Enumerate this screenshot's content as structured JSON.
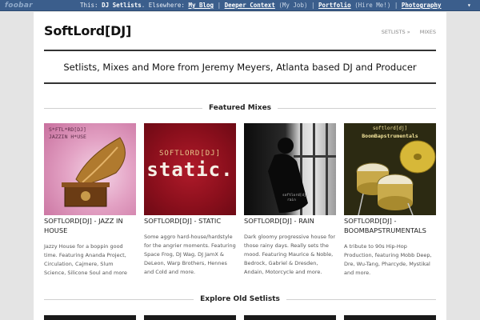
{
  "topbar": {
    "brand": "foobar",
    "this_label": "This:",
    "this_site": "DJ Setlists",
    "elsewhere_label": ". Elsewhere:",
    "links": [
      {
        "label": "My Blog",
        "note": ""
      },
      {
        "label": "Deeper Context",
        "note": "(My Job)"
      },
      {
        "label": "Portfolio",
        "note": "(Hire Me!)"
      },
      {
        "label": "Photography",
        "note": ""
      }
    ]
  },
  "header": {
    "site_title": "SoftLord[DJ]",
    "nav": [
      "SETLISTS »",
      "MIXES"
    ],
    "tagline": "Setlists, Mixes and More from Jeremy Meyers, Atlanta based DJ and Producer"
  },
  "featured": {
    "heading": "Featured Mixes",
    "mixes": [
      {
        "title": "SOFTLORD[DJ] - JAZZ IN HOUSE",
        "description": "Jazzy House for a boppin good time. Featuring Ananda Project, Circulation, Cajmere, Slum Science, Silicone Soul and more",
        "cover_text_top": "S*FTL*RD[DJ]",
        "cover_text_sub": "JAZZIN H*USE",
        "cover_color": "#e3a2c4"
      },
      {
        "title": "SOFTLORD[DJ] - STATIC",
        "description": "Some aggro hard-house/hardstyle for the angrier moments. Featuring Space Frog, DJ Wag, DJ JamX & DeLeon, Warp Brothers, Hennes and Cold and more.",
        "cover_text_top": "SOFTLORD[DJ]",
        "cover_text_sub": "static.",
        "cover_color": "#8a0f1c"
      },
      {
        "title": "SOFTLORD[DJ] - RAIN",
        "description": "Dark gloomy progressive house for those rainy days. Really sets the mood. Featuring Maurice & Noble, Bedrock, Gabriel & Dresden, Andain, Motorcycle and more.",
        "cover_text_top": "softlord[dj]",
        "cover_text_sub": "rain",
        "cover_color": "#1a1a1a"
      },
      {
        "title": "SOFTLORD[DJ] - BOOMBAPSTRUMENTALS",
        "description": "A tribute to 90s Hip-Hop Production, featuring Mobb Deep, Dre, Wu-Tang, Pharcyde, Mystikal and more.",
        "cover_text_top": "softlord[dj]",
        "cover_text_sub": "BoomBapstrumentals",
        "cover_color": "#c9b23a"
      }
    ]
  },
  "explore": {
    "heading": "Explore Old Setlists"
  }
}
